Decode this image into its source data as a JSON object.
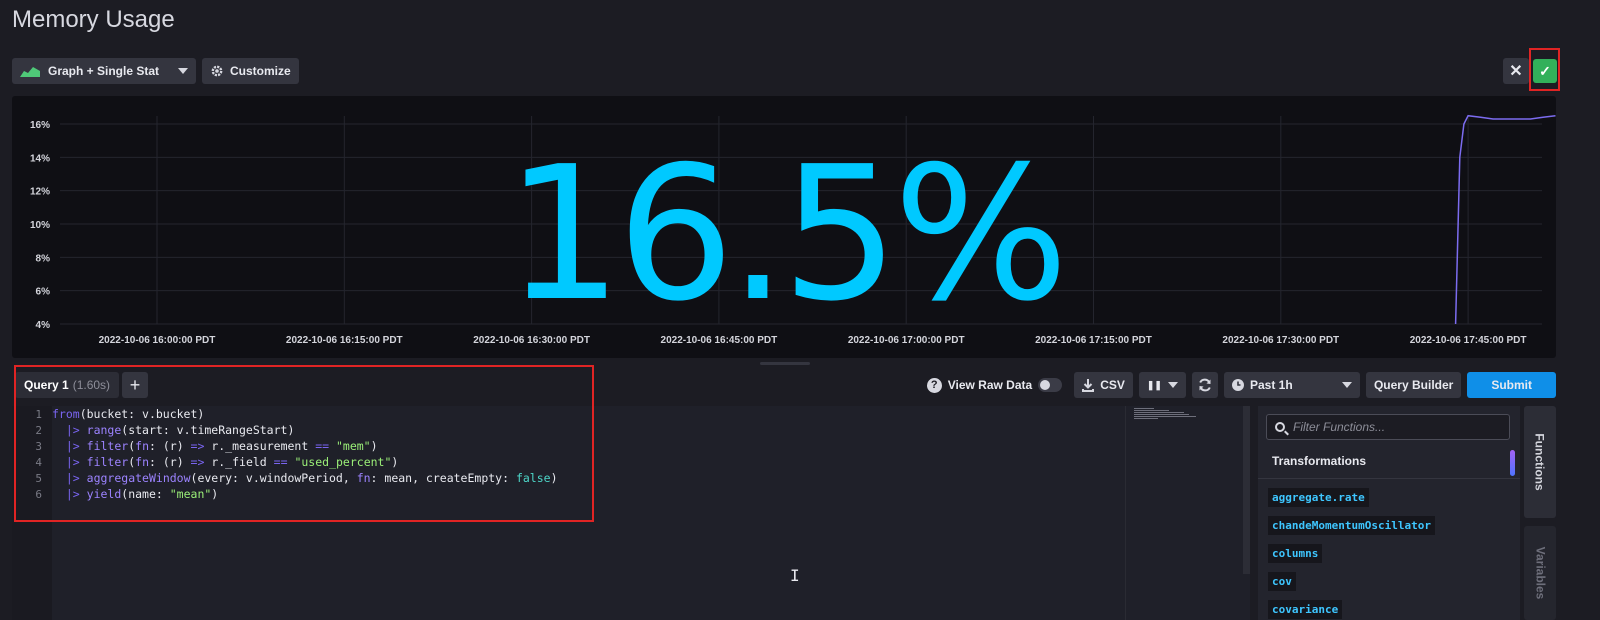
{
  "header": {
    "title": "Memory Usage"
  },
  "toolbar": {
    "viz_type": "Graph + Single Stat",
    "customize": "Customize"
  },
  "actions": {
    "close_glyph": "✕",
    "confirm_glyph": "✓"
  },
  "graph": {
    "single_stat": "16.5%",
    "y_ticks": [
      "16%",
      "14%",
      "12%",
      "10%",
      "8%",
      "6%",
      "4%"
    ],
    "x_ticks": [
      "2022-10-06 16:00:00 PDT",
      "2022-10-06 16:15:00 PDT",
      "2022-10-06 16:30:00 PDT",
      "2022-10-06 16:45:00 PDT",
      "2022-10-06 17:00:00 PDT",
      "2022-10-06 17:15:00 PDT",
      "2022-10-06 17:30:00 PDT",
      "2022-10-06 17:45:00 PDT"
    ],
    "line_color": "#7c6cf0",
    "stat_color": "#00c9ff"
  },
  "chart_data": {
    "type": "line",
    "x": [
      "2022-10-06 17:44:00",
      "2022-10-06 17:44:20",
      "2022-10-06 17:44:40",
      "2022-10-06 17:45:00",
      "2022-10-06 17:46:00",
      "2022-10-06 17:47:00",
      "2022-10-06 17:48:00",
      "2022-10-06 17:49:00",
      "2022-10-06 17:50:00",
      "2022-10-06 17:51:00",
      "2022-10-06 17:52:00"
    ],
    "series": [
      {
        "values": [
          4.0,
          14.0,
          16.0,
          16.5,
          16.4,
          16.3,
          16.3,
          16.3,
          16.3,
          16.4,
          16.5
        ]
      }
    ],
    "ylim": [
      4,
      16.5
    ],
    "grid": true
  },
  "query": {
    "tab_name": "Query 1",
    "tab_time": "(1.60s)",
    "add_glyph": "+",
    "view_raw": "View Raw Data",
    "csv": "CSV",
    "pause_glyph": "❚❚",
    "time_range": "Past 1h",
    "query_builder": "Query Builder",
    "submit": "Submit"
  },
  "editor": {
    "line_numbers": [
      "1",
      "2",
      "3",
      "4",
      "5",
      "6"
    ]
  },
  "functions": {
    "search_placeholder": "Filter Functions...",
    "category": "Transformations",
    "items": [
      "aggregate.rate",
      "chandeMomentumOscillator",
      "columns",
      "cov",
      "covariance"
    ],
    "side_tabs": [
      "Functions",
      "Variables"
    ]
  }
}
